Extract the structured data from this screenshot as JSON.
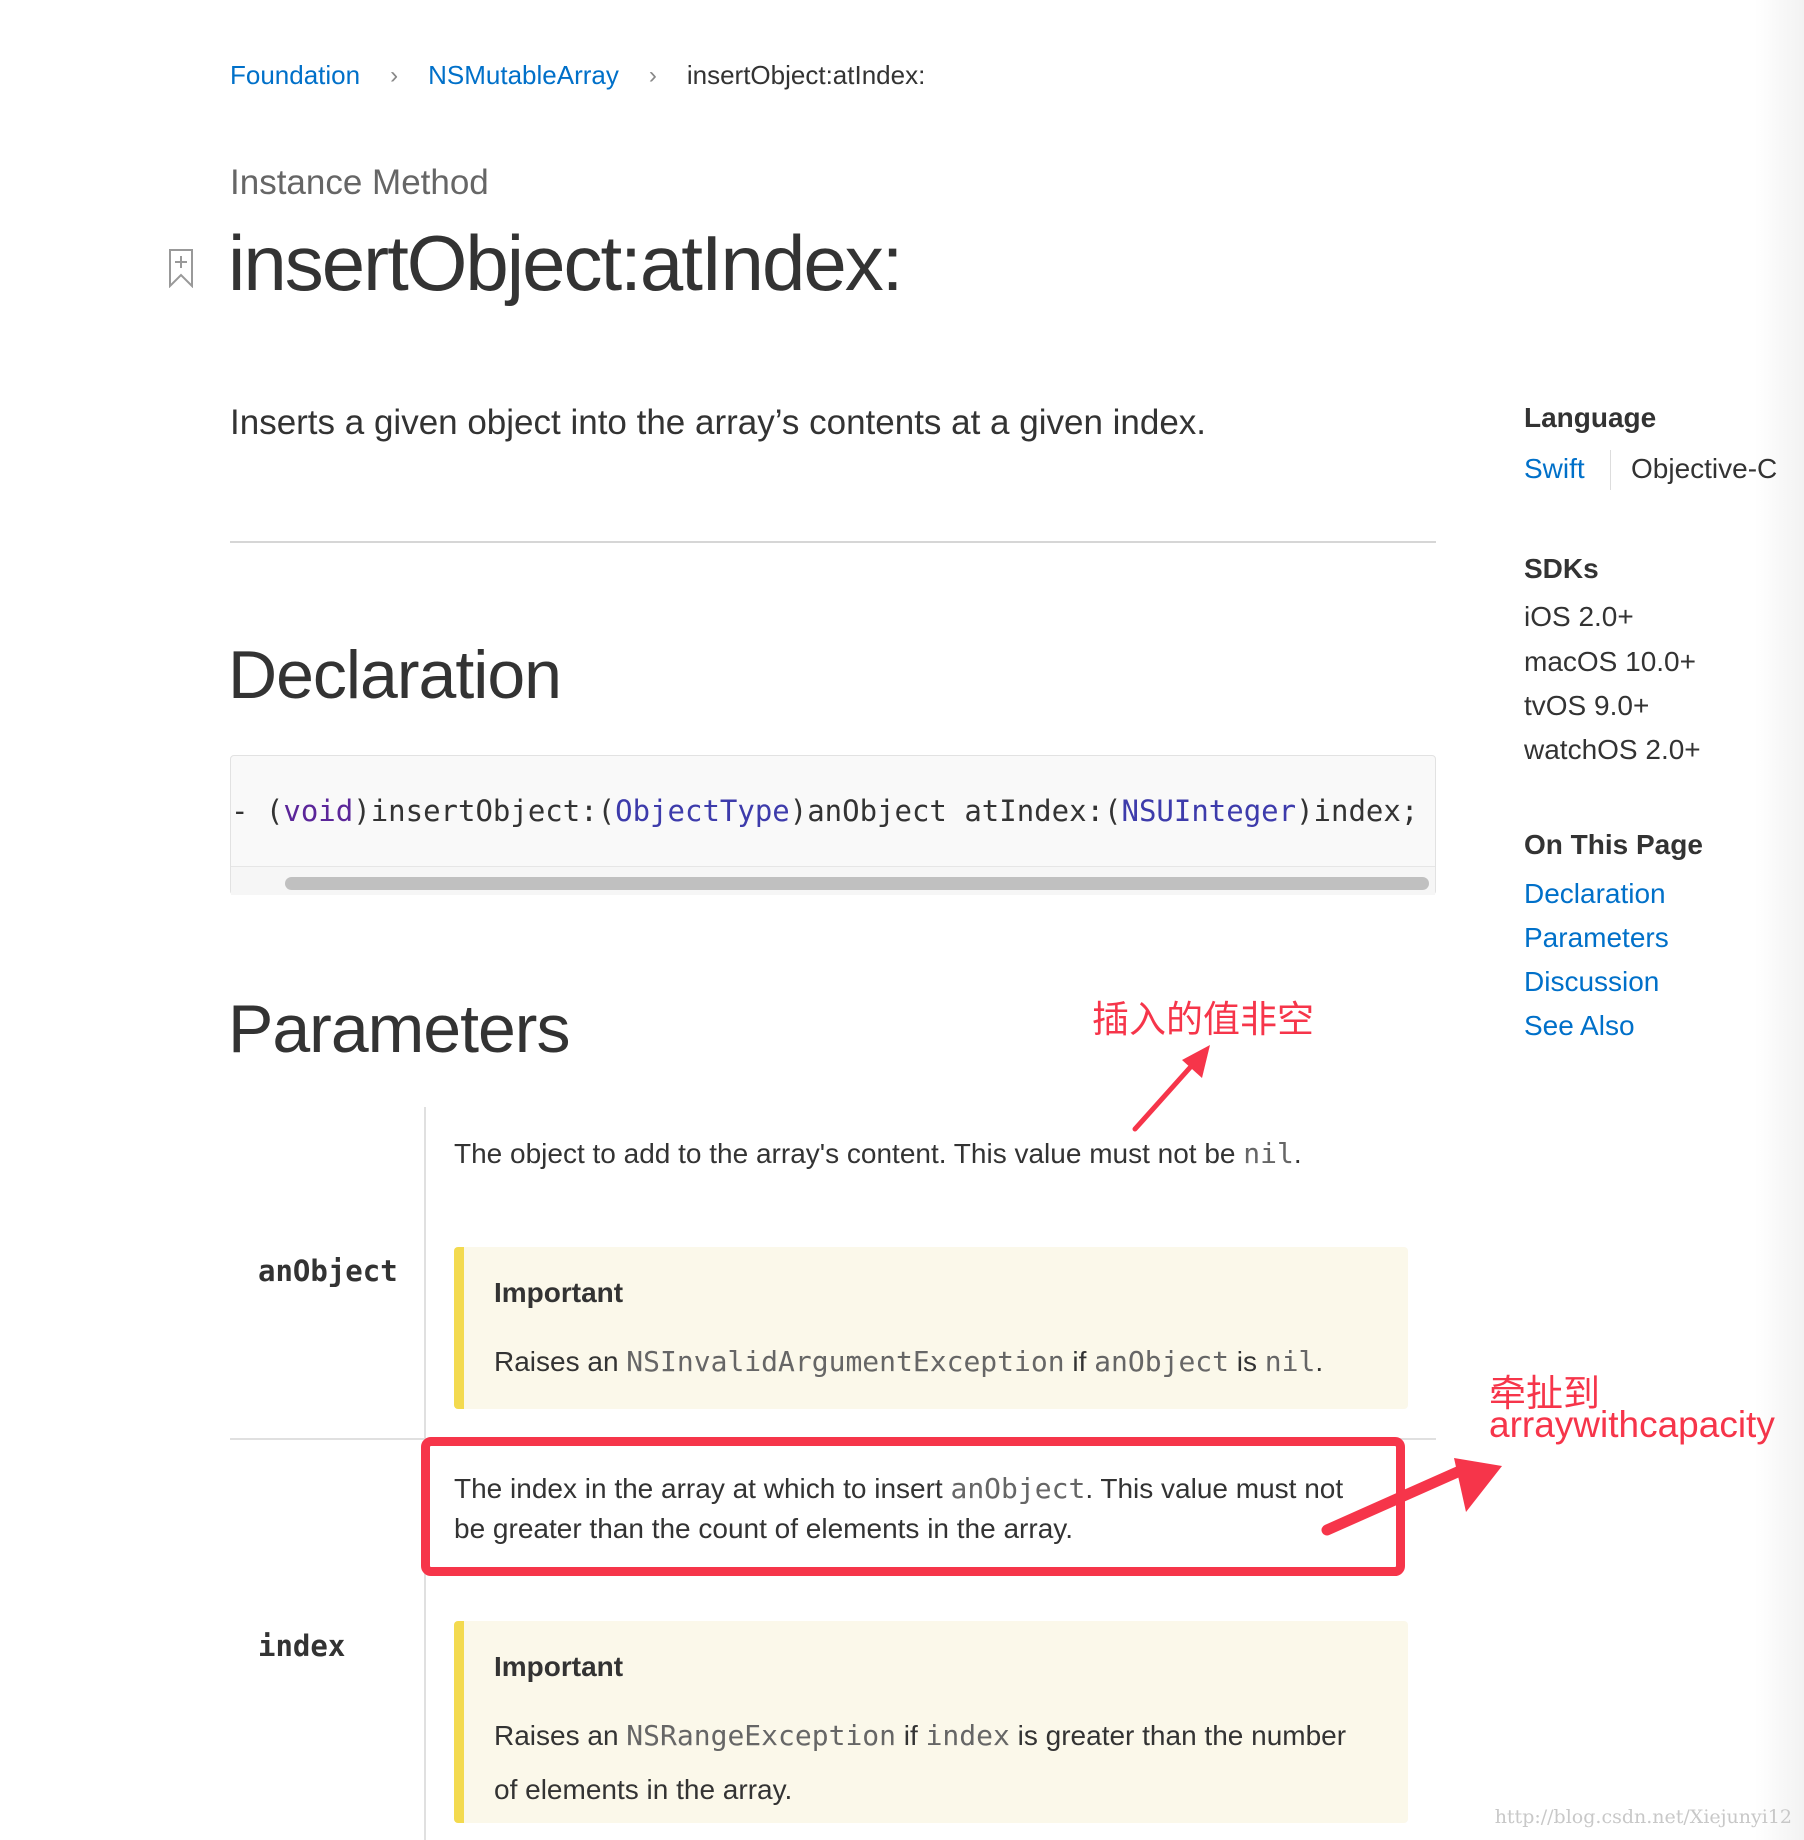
{
  "breadcrumb": {
    "items": [
      "Foundation",
      "NSMutableArray"
    ],
    "current": "insertObject:atIndex:",
    "separator": "›"
  },
  "eyebrow": "Instance Method",
  "title": "insertObject:atIndex:",
  "abstract": "Inserts a given object into the array’s contents at a given index.",
  "declaration": {
    "heading": "Declaration",
    "code": {
      "prefix": "- (",
      "void": "void",
      "p1": ")insertObject:(",
      "t1": "ObjectType",
      "p2": ")anObject atIndex:(",
      "t2": "NSUInteger",
      "p3": ")index;"
    }
  },
  "parameters": {
    "heading": "Parameters",
    "items": [
      {
        "name": "anObject",
        "text_a": "The object to add to the array's content. This value must not be ",
        "code_a": "nil",
        "text_b": ".",
        "important_label": "Important",
        "important": {
          "t1": "Raises an ",
          "c1": "NSInvalidArgumentException",
          "t2": " if ",
          "c2": "anObject",
          "t3": " is ",
          "c3": "nil",
          "t4": "."
        }
      },
      {
        "name": "index",
        "text_a": "The index in the array at which to insert ",
        "code_a": "anObject",
        "text_b": ". This value must not",
        "text_c": "be greater than the count of elements in the array.",
        "important_label": "Important",
        "important": {
          "t1": "Raises an ",
          "c1": "NSRangeException",
          "t2": " if ",
          "c2": "index",
          "t3": " is greater than the number",
          "line2": "of elements in the array."
        }
      }
    ]
  },
  "sidebar": {
    "language_heading": "Language",
    "languages": [
      "Swift",
      "Objective-C"
    ],
    "sdks_heading": "SDKs",
    "sdks": [
      "iOS 2.0+",
      "macOS 10.0+",
      "tvOS 9.0+",
      "watchOS 2.0+"
    ],
    "on_this_page_heading": "On This Page",
    "on_this_page": [
      "Declaration",
      "Parameters",
      "Discussion",
      "See Also"
    ]
  },
  "annotations": {
    "note1": "插入的值非空",
    "note2_line1": "牵扯到",
    "note2_line2": "arraywithcapacity",
    "color": "#f6354a"
  },
  "watermark": "http://blog.csdn.net/Xiejunyi12",
  "colors": {
    "link": "#0070c9",
    "aside_bg": "#fbf8ea",
    "aside_bar": "#f3da4f"
  }
}
